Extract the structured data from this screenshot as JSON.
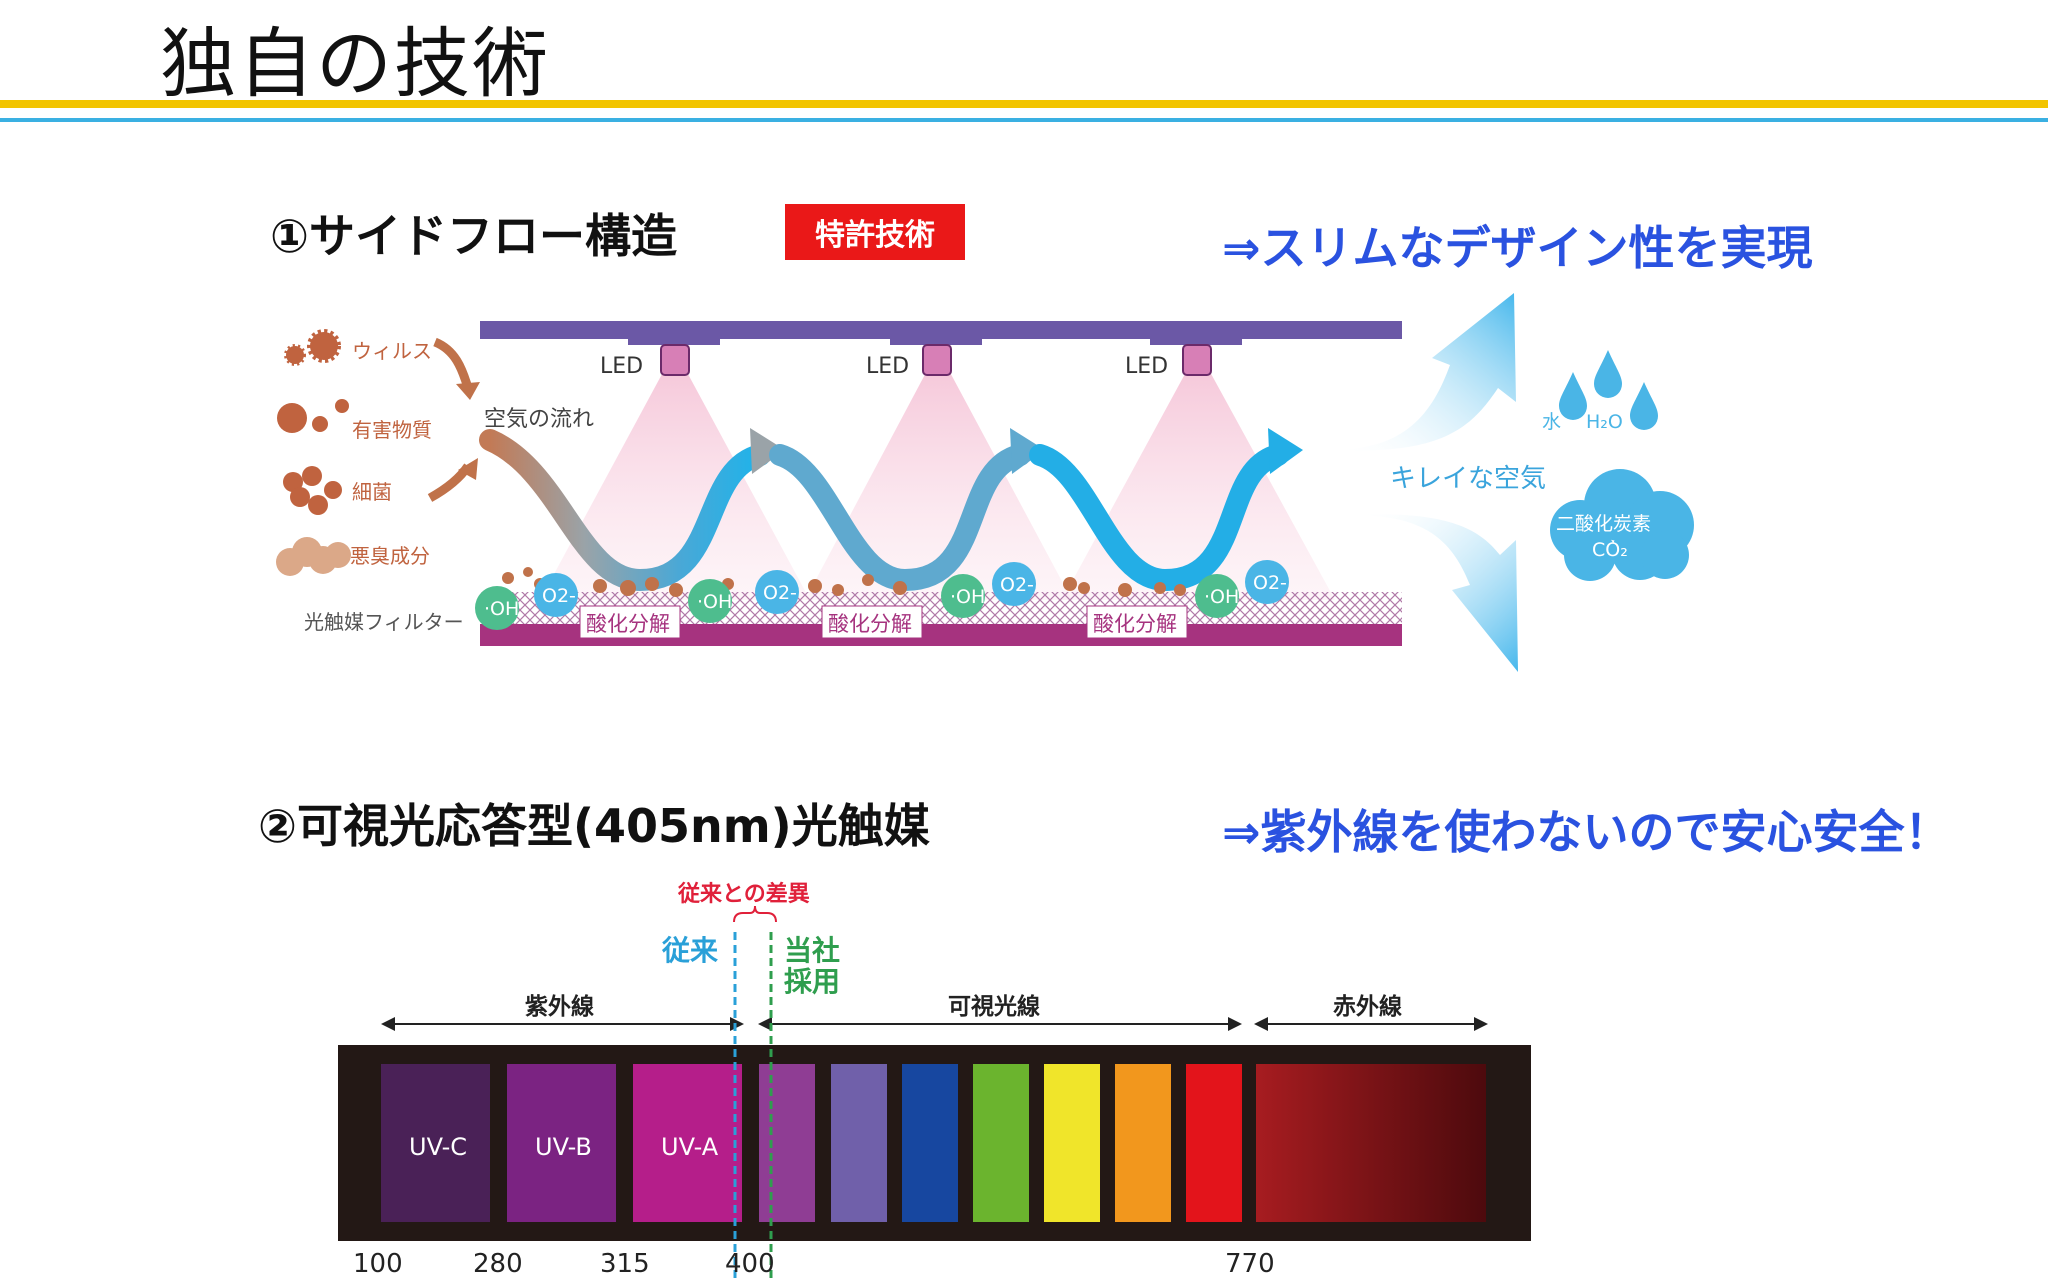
{
  "page": {
    "title": "独自の技術"
  },
  "section1": {
    "heading": "①サイドフロー構造",
    "badge": "特許技術",
    "claim": "⇒スリムなデザイン性を実現",
    "diagram": {
      "pollutants": [
        "ウィルス",
        "有害物質",
        "細菌",
        "悪臭成分"
      ],
      "airflow_label": "空気の流れ",
      "led_label": "LED",
      "filter_label": "光触媒フィルター",
      "oh_label": "·OH",
      "o2_label": "O2-",
      "decompose_label": "酸化分解",
      "clean_air_label": "キレイな空気",
      "water_label": "水",
      "h2o_label": "H₂O",
      "co2_label_1": "二酸化炭素",
      "co2_label_2": "CO₂"
    }
  },
  "section2": {
    "heading": "②可視光応答型(405nm)光触媒",
    "claim": "⇒紫外線を使わないので安心安全！",
    "spectrum": {
      "difference_label": "従来との差異",
      "conventional_label": "従来",
      "ours_label_1": "当社",
      "ours_label_2": "採用",
      "uv_label": "紫外線",
      "visible_label": "可視光線",
      "ir_label": "赤外線",
      "band_labels": [
        "UV-C",
        "UV-B",
        "UV-A"
      ],
      "ticks": [
        "100",
        "280",
        "315",
        "400",
        "770"
      ],
      "band_colors": [
        "#4a2157",
        "#7b2382",
        "#b51e8a",
        "#8f3d94",
        "#7060aa",
        "#1747a0",
        "#6bb42e",
        "#f0e52a",
        "#f2971d",
        "#e3141b"
      ],
      "ir_gradient": [
        "#a71c20",
        "#4d0a0d"
      ]
    }
  }
}
